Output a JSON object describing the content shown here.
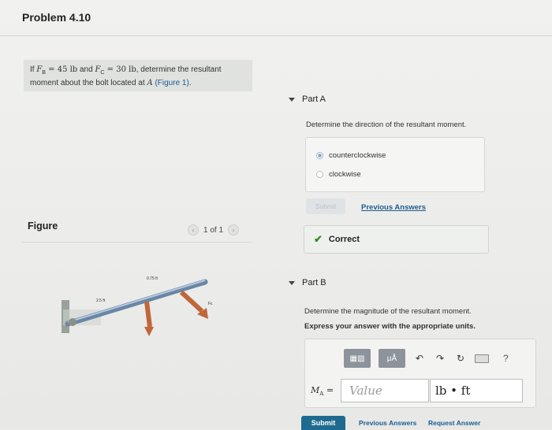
{
  "problem": {
    "title": "Problem 4.10",
    "statement_pre": "If ",
    "fb_label": "F",
    "fb_sub": "B",
    "fb_value": " = 45 lb",
    "and_text": " and ",
    "fc_label": "F",
    "fc_sub": "C",
    "fc_value": " = 30 lb",
    "statement_mid": ", determine the resultant moment about the bolt located at ",
    "point": "A",
    "statement_link": " (Figure 1)",
    "statement_end": "."
  },
  "figure": {
    "label": "Figure",
    "pager_text": "1 of 1",
    "prev_icon": "chevron-left-icon",
    "next_icon": "chevron-right-icon",
    "dim_1": "0.75 ft",
    "dim_2": "2.5 ft",
    "force_c": "Fc"
  },
  "part_a": {
    "title": "Part A",
    "question": "Determine the direction of the resultant moment.",
    "options": [
      {
        "label": "counterclockwise",
        "selected": true
      },
      {
        "label": "clockwise",
        "selected": false
      }
    ],
    "submit_label": "Submit",
    "previous_answers": "Previous Answers",
    "result": "Correct",
    "result_icon": "checkmark-icon"
  },
  "part_b": {
    "title": "Part B",
    "question": "Determine the magnitude of the resultant moment.",
    "instruction": "Express your answer with the appropriate units.",
    "toolbar": {
      "templates_icon": "templates-icon",
      "units_btn": "μÅ",
      "undo_icon": "undo-icon",
      "redo_icon": "redo-icon",
      "reset_icon": "reset-icon",
      "keyboard_icon": "keyboard-icon",
      "help": "?"
    },
    "var_label": "M",
    "var_sub": "A",
    "equals": "=",
    "value_placeholder": "Value",
    "units_value": "lb • ft",
    "submit_label": "Submit",
    "previous_answers": "Previous Answers",
    "request_answer": "Request Answer"
  },
  "colors": {
    "accent": "#1f6b8f",
    "link": "#1b5d91",
    "correct": "#3a8a2a"
  }
}
